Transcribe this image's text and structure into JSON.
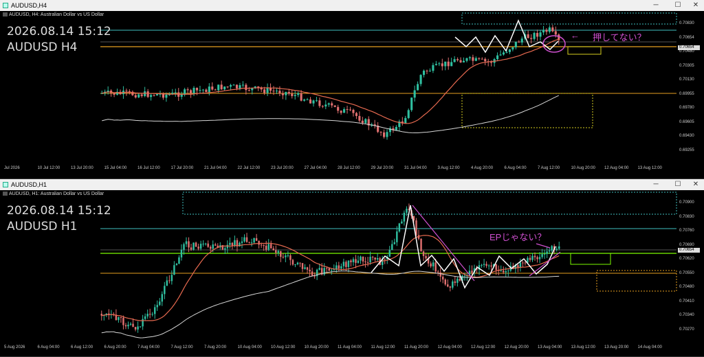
{
  "top": {
    "window_title": "AUDUSD,H4",
    "header": "AUDUSD, H4:  Australian Dollar vs US Dollar",
    "datetime": "2026.08.14 15:12",
    "symbol_tf": "AUDUSD H4",
    "note": "押してない？",
    "note_arrow": "←",
    "price_labels": [
      "0.70830",
      "0.70654",
      "0.70480",
      "0.70305",
      "0.70130",
      "0.69955",
      "0.69780",
      "0.69605",
      "0.69430",
      "0.69255"
    ],
    "current_price": "0.70654",
    "time_labels": [
      "Jul 2026",
      "10 Jul 12:00",
      "13 Jul 20:00",
      "15 Jul 04:00",
      "16 Jul 12:00",
      "17 Jul 20:00",
      "21 Jul 04:00",
      "22 Jul 12:00",
      "23 Jul 20:00",
      "27 Jul 04:00",
      "28 Jul 12:00",
      "29 Jul 20:00",
      "31 Jul 04:00",
      "3 Aug 12:00",
      "4 Aug 20:00",
      "6 Aug 04:00",
      "7 Aug 12:00",
      "10 Aug 20:00",
      "12 Aug 04:00",
      "13 Aug 12:00"
    ]
  },
  "bottom": {
    "window_title": "AUDUSD,H1",
    "header": "AUDUSD, H1:  Australian Dollar vs US Dollar",
    "datetime": "2026.08.14 15:12",
    "symbol_tf": "AUDUSD H1",
    "note": "EPじゃない？",
    "price_labels": [
      "0.70900",
      "0.70830",
      "0.70760",
      "0.70690",
      "0.70620",
      "0.70550",
      "0.70480",
      "0.70410",
      "0.70340",
      "0.70270"
    ],
    "current_price": "0.70654",
    "time_labels": [
      "5 Aug 2026",
      "6 Aug 04:00",
      "6 Aug 12:00",
      "6 Aug 20:00",
      "7 Aug 04:00",
      "7 Aug 12:00",
      "7 Aug 20:00",
      "10 Aug 04:00",
      "10 Aug 12:00",
      "10 Aug 20:00",
      "11 Aug 04:00",
      "11 Aug 12:00",
      "11 Aug 20:00",
      "12 Aug 04:00",
      "12 Aug 12:00",
      "12 Aug 20:00",
      "13 Aug 04:00",
      "13 Aug 12:00",
      "13 Aug 20:00",
      "14 Aug 04:00"
    ]
  },
  "window_buttons": {
    "minimize": "─",
    "maximize": "☐",
    "close": "✕"
  },
  "colors": {
    "bull": "#2fbfa0",
    "bear": "#e07070",
    "ma_fast": "#e86a50",
    "ma_slow": "#d8d8d8",
    "orange_line": "#e8a020",
    "green_line": "#7cfc00",
    "cyan_line": "#40c0c0",
    "note": "#d050d0",
    "yellow_box": "#d8d020"
  }
}
